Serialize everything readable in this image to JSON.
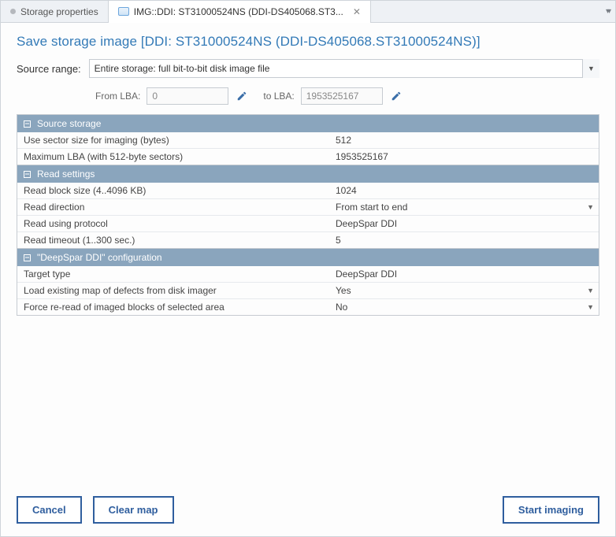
{
  "tabs": {
    "inactive_label": "Storage properties",
    "active_label": "IMG::DDI: ST31000524NS (DDI-DS405068.ST3..."
  },
  "page_title": "Save storage image [DDI: ST31000524NS (DDI-DS405068.ST31000524NS)]",
  "source_range": {
    "label": "Source range:",
    "selected": "Entire storage: full bit-to-bit disk image file",
    "from_label": "From LBA:",
    "from_value": "0",
    "to_label": "to LBA:",
    "to_value": "1953525167"
  },
  "sections": {
    "source_storage": {
      "title": "Source storage",
      "rows": [
        {
          "label": "Use sector size for imaging (bytes)",
          "value": "512"
        },
        {
          "label": "Maximum LBA (with 512-byte sectors)",
          "value": "1953525167"
        }
      ]
    },
    "read_settings": {
      "title": "Read settings",
      "rows": [
        {
          "label": "Read block size (4..4096 KB)",
          "value": "1024",
          "dropdown": false
        },
        {
          "label": "Read direction",
          "value": "From start to end",
          "dropdown": true
        },
        {
          "label": "Read using protocol",
          "value": "DeepSpar DDI",
          "dropdown": false
        },
        {
          "label": "Read timeout (1..300 sec.)",
          "value": "5",
          "dropdown": false
        }
      ]
    },
    "ddi_config": {
      "title": "\"DeepSpar DDI\" configuration",
      "rows": [
        {
          "label": "Target type",
          "value": "DeepSpar DDI",
          "dropdown": false
        },
        {
          "label": "Load existing map of defects from disk imager",
          "value": "Yes",
          "dropdown": true
        },
        {
          "label": "Force re-read of imaged blocks of selected area",
          "value": "No",
          "dropdown": true
        }
      ]
    }
  },
  "buttons": {
    "cancel": "Cancel",
    "clear_map": "Clear map",
    "start": "Start imaging"
  }
}
